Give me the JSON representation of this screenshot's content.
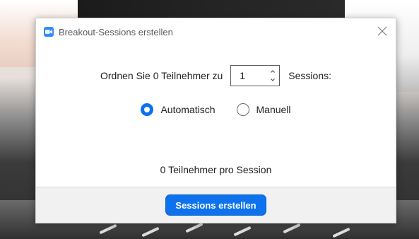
{
  "window": {
    "title": "Breakout-Sessions erstellen",
    "app_icon": "zoom-camera-icon",
    "close_icon": "close-icon"
  },
  "assign": {
    "prefix": "Ordnen Sie 0 Teilnehmer zu",
    "sessions_value": "1",
    "suffix": "Sessions:"
  },
  "mode": {
    "options": [
      {
        "label": "Automatisch",
        "selected": true
      },
      {
        "label": "Manuell",
        "selected": false
      }
    ]
  },
  "summary": {
    "per_session": "0 Teilnehmer pro Session"
  },
  "footer": {
    "create_label": "Sessions erstellen"
  },
  "colors": {
    "accent": "#0e72ed",
    "app_icon_bg": "#2d8cff",
    "footer_bg": "#f1f1f1"
  }
}
